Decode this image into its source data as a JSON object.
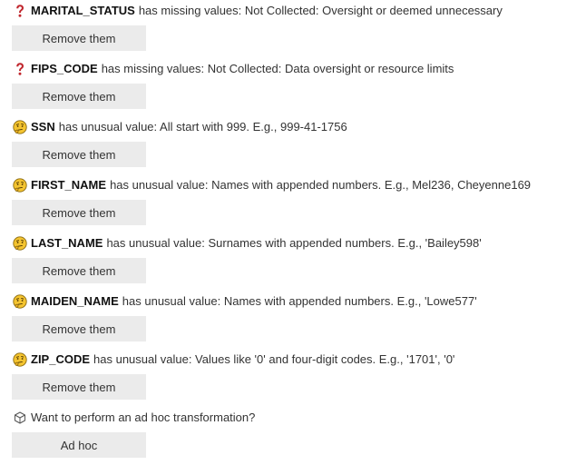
{
  "issues": [
    {
      "icon": "question-mark-icon",
      "column": "MARITAL_STATUS",
      "message": "has missing values: Not Collected: Oversight or deemed unnecessary",
      "button": "Remove them"
    },
    {
      "icon": "question-mark-icon",
      "column": "FIPS_CODE",
      "message": "has missing values: Not Collected: Data oversight or resource limits",
      "button": "Remove them"
    },
    {
      "icon": "thinking-face-icon",
      "column": "SSN",
      "message": "has unusual value: All start with 999. E.g., 999-41-1756",
      "button": "Remove them"
    },
    {
      "icon": "thinking-face-icon",
      "column": "FIRST_NAME",
      "message": "has unusual value: Names with appended numbers. E.g., Mel236, Cheyenne169",
      "button": "Remove them"
    },
    {
      "icon": "thinking-face-icon",
      "column": "LAST_NAME",
      "message": "has unusual value: Surnames with appended numbers. E.g., 'Bailey598'",
      "button": "Remove them"
    },
    {
      "icon": "thinking-face-icon",
      "column": "MAIDEN_NAME",
      "message": "has unusual value: Names with appended numbers. E.g., 'Lowe577'",
      "button": "Remove them"
    },
    {
      "icon": "thinking-face-icon",
      "column": "ZIP_CODE",
      "message": "has unusual value: Values like '0' and four-digit codes. E.g., '1701', '0'",
      "button": "Remove them"
    }
  ],
  "adhoc": {
    "icon": "cube-icon",
    "prompt": "Want to perform an ad hoc transformation?",
    "button": "Ad hoc"
  },
  "colors": {
    "question_mark": "#c0262d",
    "emoji_face": "#f4c430",
    "button_bg": "#ebebeb"
  }
}
